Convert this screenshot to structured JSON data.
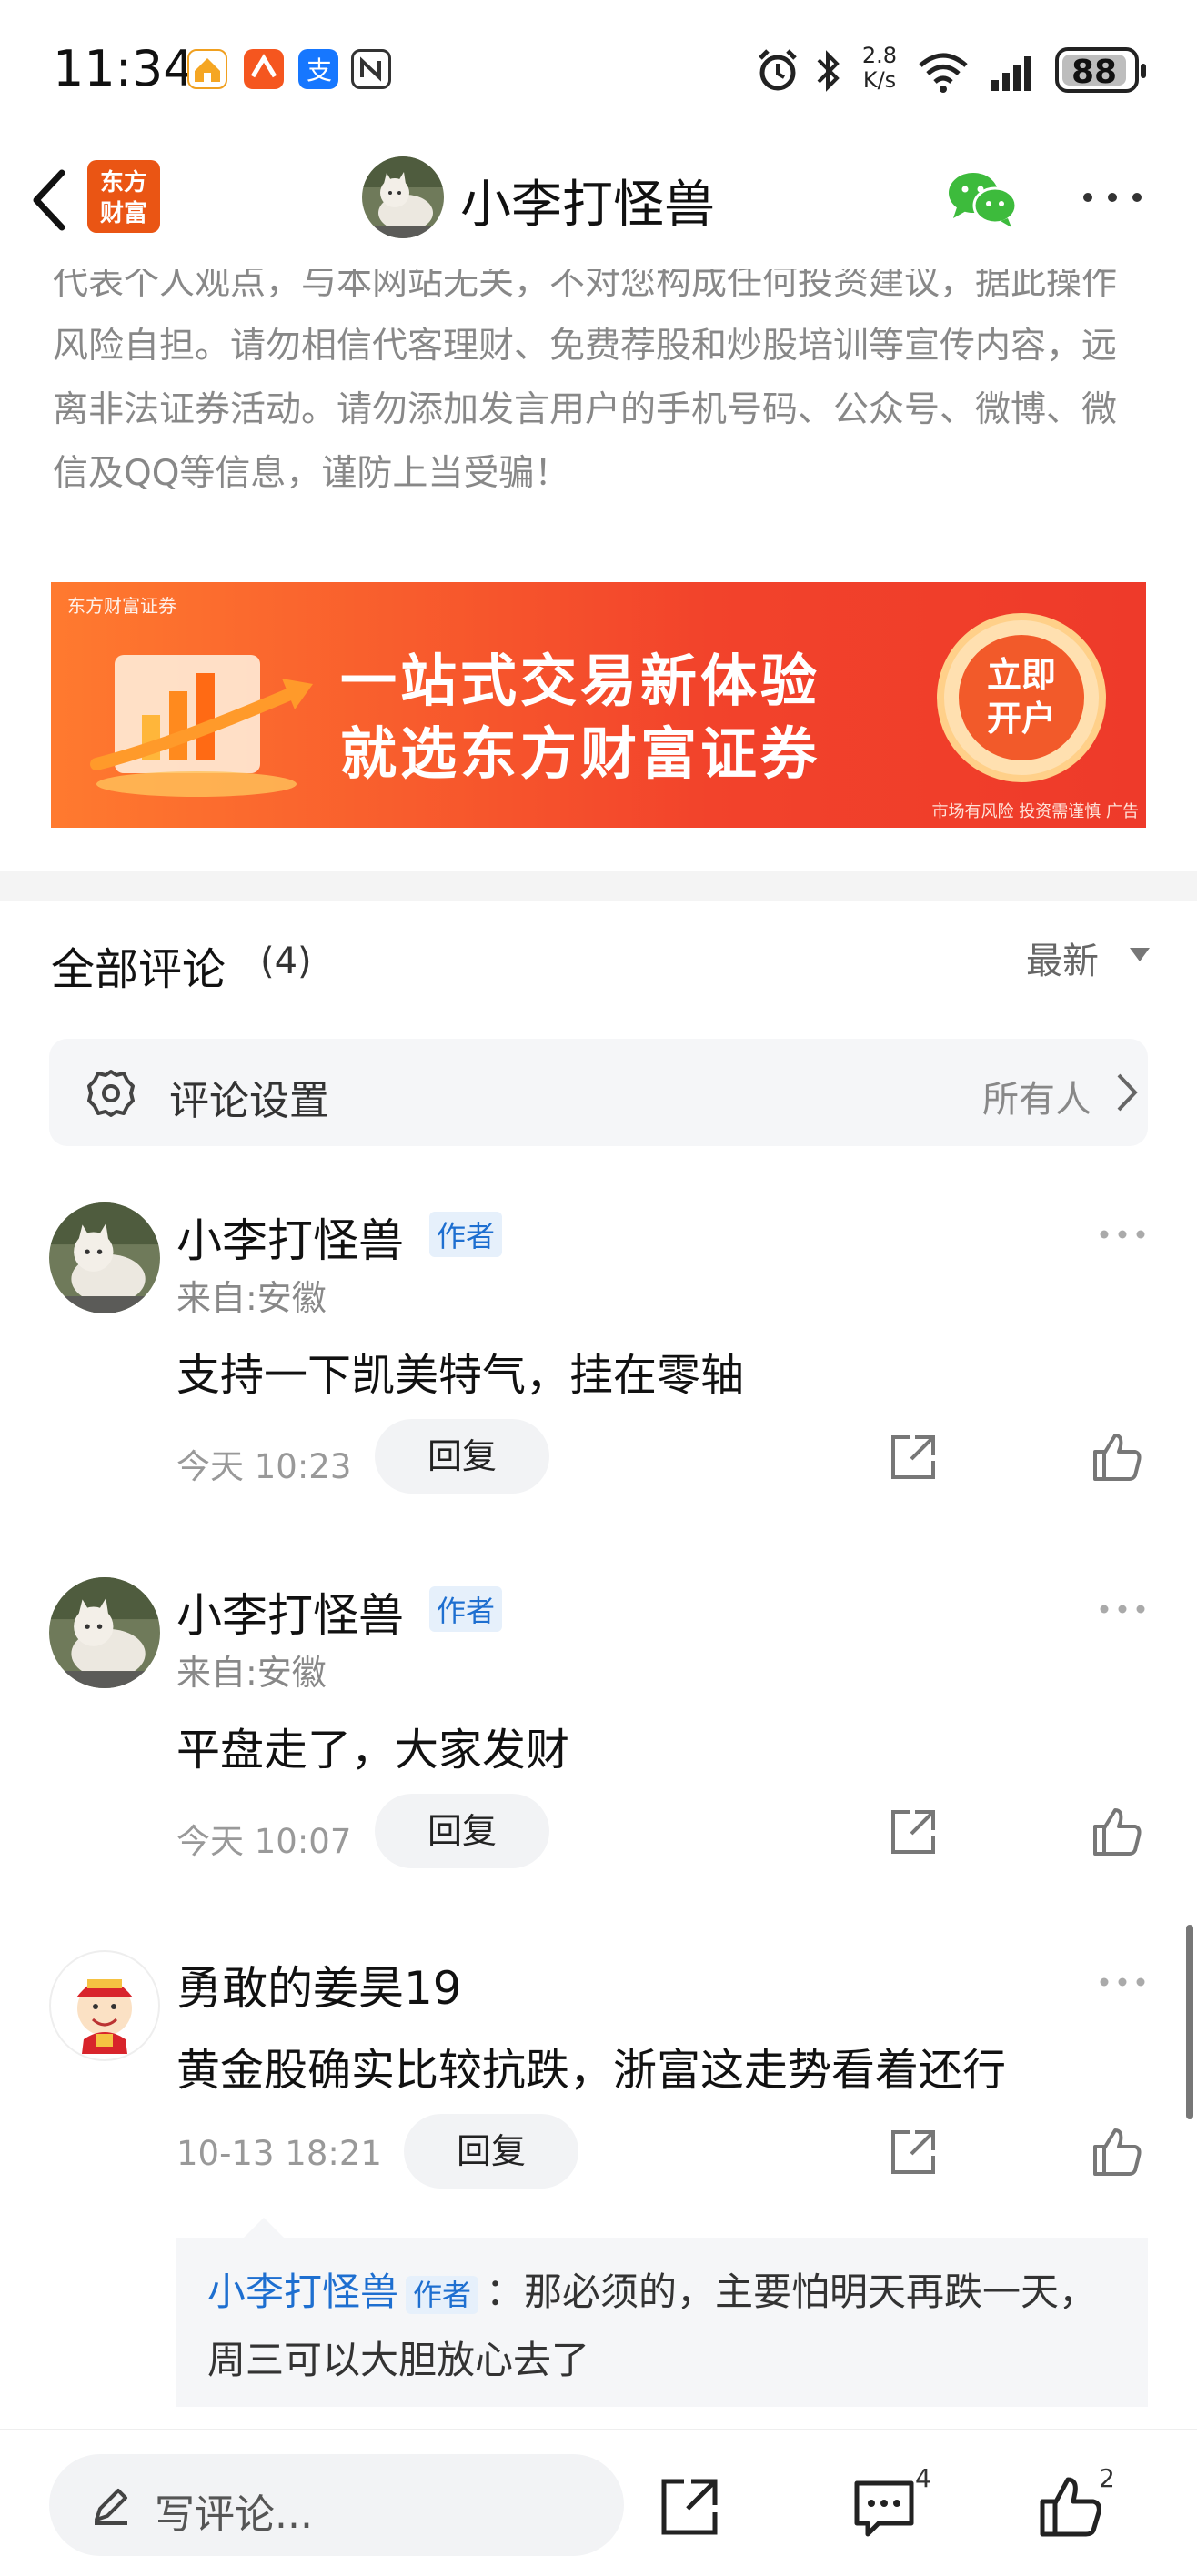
{
  "status_bar": {
    "time": "11:34",
    "network_speed_value": "2.8",
    "network_speed_unit": "K/s",
    "battery": "88"
  },
  "header": {
    "logo_line1": "东方",
    "logo_line2": "财富",
    "title": "小李打怪兽"
  },
  "disclaimer": "代表个人观点，与本网站无关，不对您构成任何投资建议，据此操作风险自担。请勿相信代客理财、免费荐股和炒股培训等宣传内容，远离非法证券活动。请勿添加发言用户的手机号码、公众号、微博、微信及QQ等信息，谨防上当受骗！",
  "banner": {
    "brand": "东方财富证券",
    "line1": "一站式交易新体验",
    "line2": "就选东方财富证券",
    "cta_line1": "立即",
    "cta_line2": "开户",
    "risk_note": "市场有风险 投资需谨慎 广告"
  },
  "comments_section": {
    "title": "全部评论",
    "count": "(4)",
    "sort_label": "最新",
    "settings_label": "评论设置",
    "settings_value": "所有人"
  },
  "comments": [
    {
      "name": "小李打怪兽",
      "badge": "作者",
      "location": "来自:安徽",
      "text": "支持一下凯美特气，挂在零轴",
      "time": "今天 10:23",
      "reply_label": "回复"
    },
    {
      "name": "小李打怪兽",
      "badge": "作者",
      "location": "来自:安徽",
      "text": "平盘走了，大家发财",
      "time": "今天 10:07",
      "reply_label": "回复"
    },
    {
      "name": "勇敢的姜昊19",
      "text": "黄金股确实比较抗跌，浙富这走势看着还行",
      "time": "10-13 18:21",
      "reply_label": "回复",
      "sub_reply": {
        "author": "小李打怪兽",
        "badge": "作者",
        "text": "：那必须的，主要怕明天再跌一天，周三可以大胆放心去了"
      }
    }
  ],
  "bottom_bar": {
    "compose_placeholder": "写评论...",
    "comment_count": "4",
    "like_count": "2"
  }
}
